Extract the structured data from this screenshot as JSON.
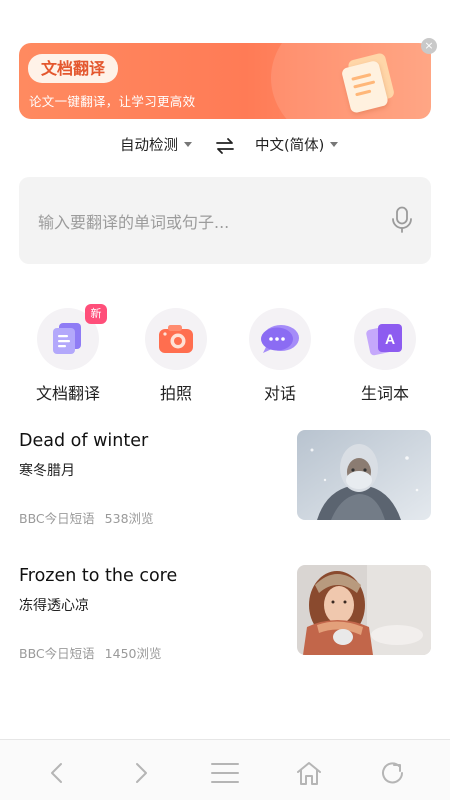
{
  "banner": {
    "title": "文档翻译",
    "subtitle": "论文一键翻译，让学习更高效",
    "close_symbol": "×",
    "accent_color": "#ff7b56"
  },
  "language_bar": {
    "source": "自动检测",
    "target": "中文(简体)",
    "swap_icon": "swap-arrows-icon"
  },
  "input": {
    "placeholder": "输入要翻译的单词或句子...",
    "mic_icon": "microphone-icon"
  },
  "tools": [
    {
      "label": "文档翻译",
      "icon": "document-icon",
      "badge": "新"
    },
    {
      "label": "拍照",
      "icon": "camera-icon"
    },
    {
      "label": "对话",
      "icon": "chat-bubble-icon"
    },
    {
      "label": "生词本",
      "icon": "vocabulary-book-icon"
    }
  ],
  "articles": [
    {
      "title_en": "Dead of winter",
      "title_zh": "寒冬腊月",
      "source": "BBC今日短语",
      "views": "538浏览",
      "thumb": "frozen-man-photo"
    },
    {
      "title_en": "Frozen to the core",
      "title_zh": "冻得透心凉",
      "source": "BBC今日短语",
      "views": "1450浏览",
      "thumb": "woman-with-scarf-photo"
    }
  ],
  "bottom_nav": [
    "back-icon",
    "forward-icon",
    "menu-icon",
    "home-icon",
    "refresh-icon"
  ]
}
